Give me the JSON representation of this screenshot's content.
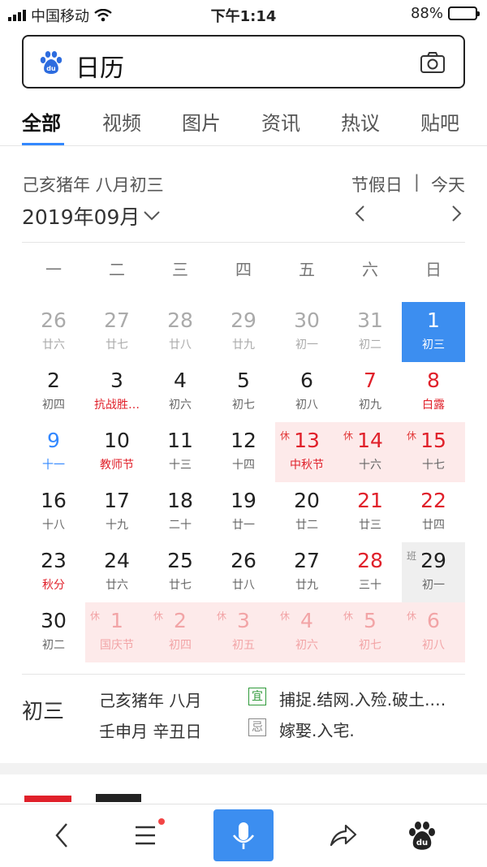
{
  "status": {
    "carrier": "中国移动",
    "time": "下午1:14",
    "battery": "88%",
    "battery_level": 0.88
  },
  "search": {
    "query": "日历"
  },
  "tabs": [
    "全部",
    "视频",
    "图片",
    "资讯",
    "热议",
    "贴吧"
  ],
  "calendar": {
    "lunar_year": "己亥猪年  八月初三",
    "month": "2019年09月",
    "holiday_link": "节假日",
    "separator": "|",
    "today_link": "今天",
    "weekdays": [
      "一",
      "二",
      "三",
      "四",
      "五",
      "六",
      "日"
    ],
    "weeks": [
      [
        {
          "n": "26",
          "s": "廿六",
          "st": "dim"
        },
        {
          "n": "27",
          "s": "廿七",
          "st": "dim"
        },
        {
          "n": "28",
          "s": "廿八",
          "st": "dim"
        },
        {
          "n": "29",
          "s": "廿九",
          "st": "dim"
        },
        {
          "n": "30",
          "s": "初一",
          "st": "dim"
        },
        {
          "n": "31",
          "s": "初二",
          "st": "dim"
        },
        {
          "n": "1",
          "s": "初三",
          "st": "today"
        }
      ],
      [
        {
          "n": "2",
          "s": "初四"
        },
        {
          "n": "3",
          "s": "抗战胜…",
          "sub": "red"
        },
        {
          "n": "4",
          "s": "初六"
        },
        {
          "n": "5",
          "s": "初七"
        },
        {
          "n": "6",
          "s": "初八"
        },
        {
          "n": "7",
          "s": "初九",
          "st": "red"
        },
        {
          "n": "8",
          "s": "白露",
          "st": "red",
          "sub": "red"
        }
      ],
      [
        {
          "n": "9",
          "s": "十一",
          "num": "blue",
          "sub": "blue"
        },
        {
          "n": "10",
          "s": "教师节",
          "sub": "red"
        },
        {
          "n": "11",
          "s": "十三"
        },
        {
          "n": "12",
          "s": "十四"
        },
        {
          "n": "13",
          "s": "中秋节",
          "st": "red hl",
          "sub": "red",
          "tag": "休"
        },
        {
          "n": "14",
          "s": "十六",
          "st": "red hl",
          "tag": "休"
        },
        {
          "n": "15",
          "s": "十七",
          "st": "red hl",
          "tag": "休"
        }
      ],
      [
        {
          "n": "16",
          "s": "十八"
        },
        {
          "n": "17",
          "s": "十九"
        },
        {
          "n": "18",
          "s": "二十"
        },
        {
          "n": "19",
          "s": "廿一"
        },
        {
          "n": "20",
          "s": "廿二"
        },
        {
          "n": "21",
          "s": "廿三",
          "st": "red"
        },
        {
          "n": "22",
          "s": "廿四",
          "st": "red"
        }
      ],
      [
        {
          "n": "23",
          "s": "秋分",
          "sub": "red"
        },
        {
          "n": "24",
          "s": "廿六"
        },
        {
          "n": "25",
          "s": "廿七"
        },
        {
          "n": "26",
          "s": "廿八"
        },
        {
          "n": "27",
          "s": "廿九"
        },
        {
          "n": "28",
          "s": "三十",
          "st": "red"
        },
        {
          "n": "29",
          "s": "初一",
          "st": "work",
          "tag": "班"
        }
      ],
      [
        {
          "n": "30",
          "s": "初二"
        },
        {
          "n": "1",
          "s": "国庆节",
          "st": "faded",
          "sub": "red",
          "tag": "休"
        },
        {
          "n": "2",
          "s": "初四",
          "st": "faded",
          "tag": "休"
        },
        {
          "n": "3",
          "s": "初五",
          "st": "faded",
          "tag": "休"
        },
        {
          "n": "4",
          "s": "初六",
          "st": "faded",
          "tag": "休"
        },
        {
          "n": "5",
          "s": "初七",
          "st": "faded",
          "tag": "休"
        },
        {
          "n": "6",
          "s": "初八",
          "st": "faded",
          "tag": "休"
        }
      ]
    ]
  },
  "detail": {
    "day": "初三",
    "line1": "己亥猪年 八月",
    "line2": "壬申月 辛丑日",
    "yi_label": "宜",
    "yi": "捕捉.结网.入殓.破土.…",
    "ji_label": "忌",
    "ji": "嫁娶.入宅."
  },
  "bottom_bar": [
    "back-icon",
    "menu-icon",
    "mic-icon",
    "share-icon",
    "baidu-paw-icon"
  ],
  "colors": {
    "accent": "#3c8ef0",
    "holiday_red": "#e0202a",
    "holiday_bg": "#fdeaea",
    "workday_bg": "#efefef",
    "yi_green": "#2f9a3a"
  }
}
